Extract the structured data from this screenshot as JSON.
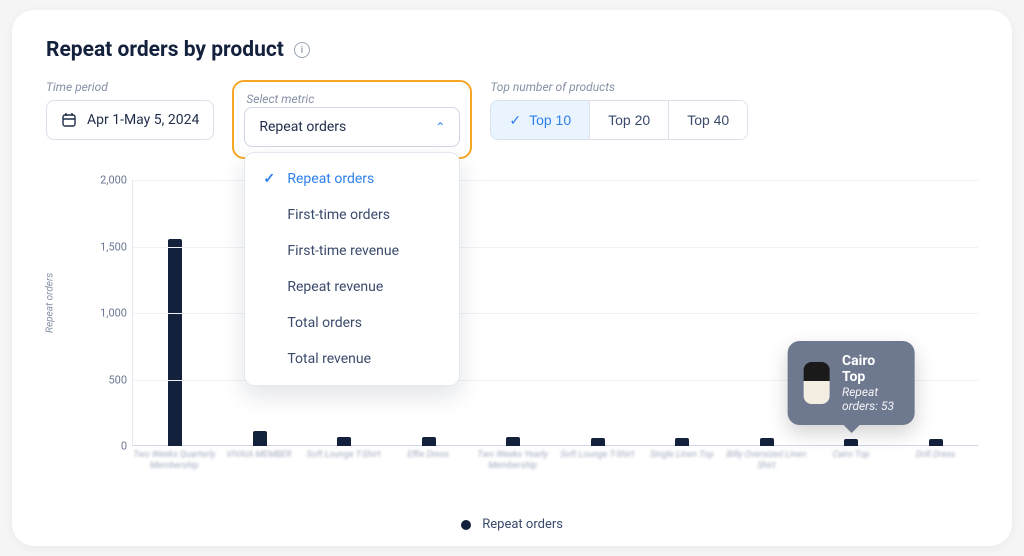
{
  "title": "Repeat orders by product",
  "controls": {
    "time_period": {
      "label": "Time period",
      "value": "Apr 1-May 5, 2024"
    },
    "metric": {
      "label": "Select metric",
      "selected": "Repeat orders",
      "options": [
        "Repeat orders",
        "First-time orders",
        "First-time revenue",
        "Repeat revenue",
        "Total orders",
        "Total revenue"
      ]
    },
    "top_n": {
      "label": "Top number of products",
      "options": [
        "Top 10",
        "Top 20",
        "Top 40"
      ],
      "selected": "Top 10"
    }
  },
  "legend": {
    "series_name": "Repeat orders"
  },
  "tooltip": {
    "product": "Cairo Top",
    "metric_label": "Repeat orders",
    "value": 53,
    "line": "Repeat orders: 53"
  },
  "chart_data": {
    "type": "bar",
    "title": "Repeat orders by product",
    "xlabel": "",
    "ylabel": "Repeat orders",
    "ylim": [
      0,
      2000
    ],
    "yticks": [
      0,
      500,
      1000,
      1500,
      2000
    ],
    "categories": [
      "Two Weeks Quarterly Membership",
      "VIVAIA MEMBER",
      "Soft Lounge T-Shirt",
      "Effie Dress",
      "Two Weeks Yearly Membership",
      "Soft Lounge T-Shirt",
      "Single Linen Top",
      "Billy Oversized Linen Shirt",
      "Cairo Top",
      "Drill Dress"
    ],
    "values": [
      1560,
      110,
      70,
      70,
      65,
      62,
      60,
      57,
      53,
      50
    ],
    "highlight_index": 8
  }
}
